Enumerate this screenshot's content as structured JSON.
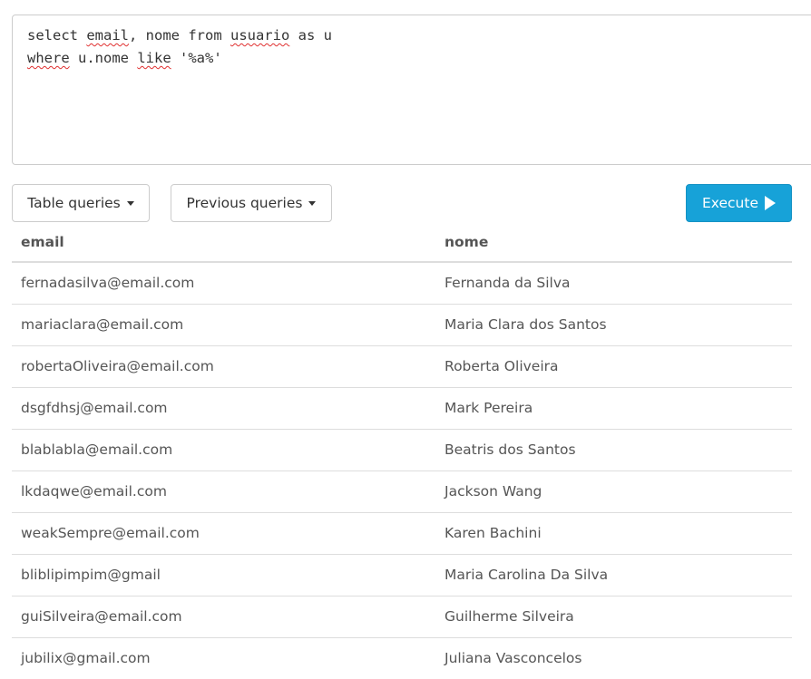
{
  "editor": {
    "line1": [
      {
        "text": "select ",
        "squiggle": false
      },
      {
        "text": "email",
        "squiggle": true
      },
      {
        "text": ", nome from ",
        "squiggle": false
      },
      {
        "text": "usuario",
        "squiggle": true
      },
      {
        "text": " as u",
        "squiggle": false
      }
    ],
    "line2": [
      {
        "text": "where",
        "squiggle": true
      },
      {
        "text": " u.nome ",
        "squiggle": false
      },
      {
        "text": "like",
        "squiggle": true
      },
      {
        "text": " '%a%'",
        "squiggle": false
      }
    ]
  },
  "toolbar": {
    "table_queries_label": "Table queries",
    "previous_queries_label": "Previous queries",
    "execute_label": "Execute",
    "execute_color": "#17a2d8"
  },
  "results": {
    "columns": [
      "email",
      "nome"
    ],
    "rows": [
      [
        "fernadasilva@email.com",
        "Fernanda da Silva"
      ],
      [
        "mariaclara@email.com",
        "Maria Clara dos Santos"
      ],
      [
        "robertaOliveira@email.com",
        "Roberta Oliveira"
      ],
      [
        "dsgfdhsj@email.com",
        "Mark Pereira"
      ],
      [
        "blablabla@email.com",
        "Beatris dos Santos"
      ],
      [
        "lkdaqwe@email.com",
        "Jackson Wang"
      ],
      [
        "weakSempre@email.com",
        "Karen Bachini"
      ],
      [
        "bliblipimpim@gmail",
        "Maria Carolina Da Silva"
      ],
      [
        "guiSilveira@email.com",
        "Guilherme Silveira"
      ],
      [
        "jubilix@gmail.com",
        "Juliana Vasconcelos"
      ]
    ]
  }
}
